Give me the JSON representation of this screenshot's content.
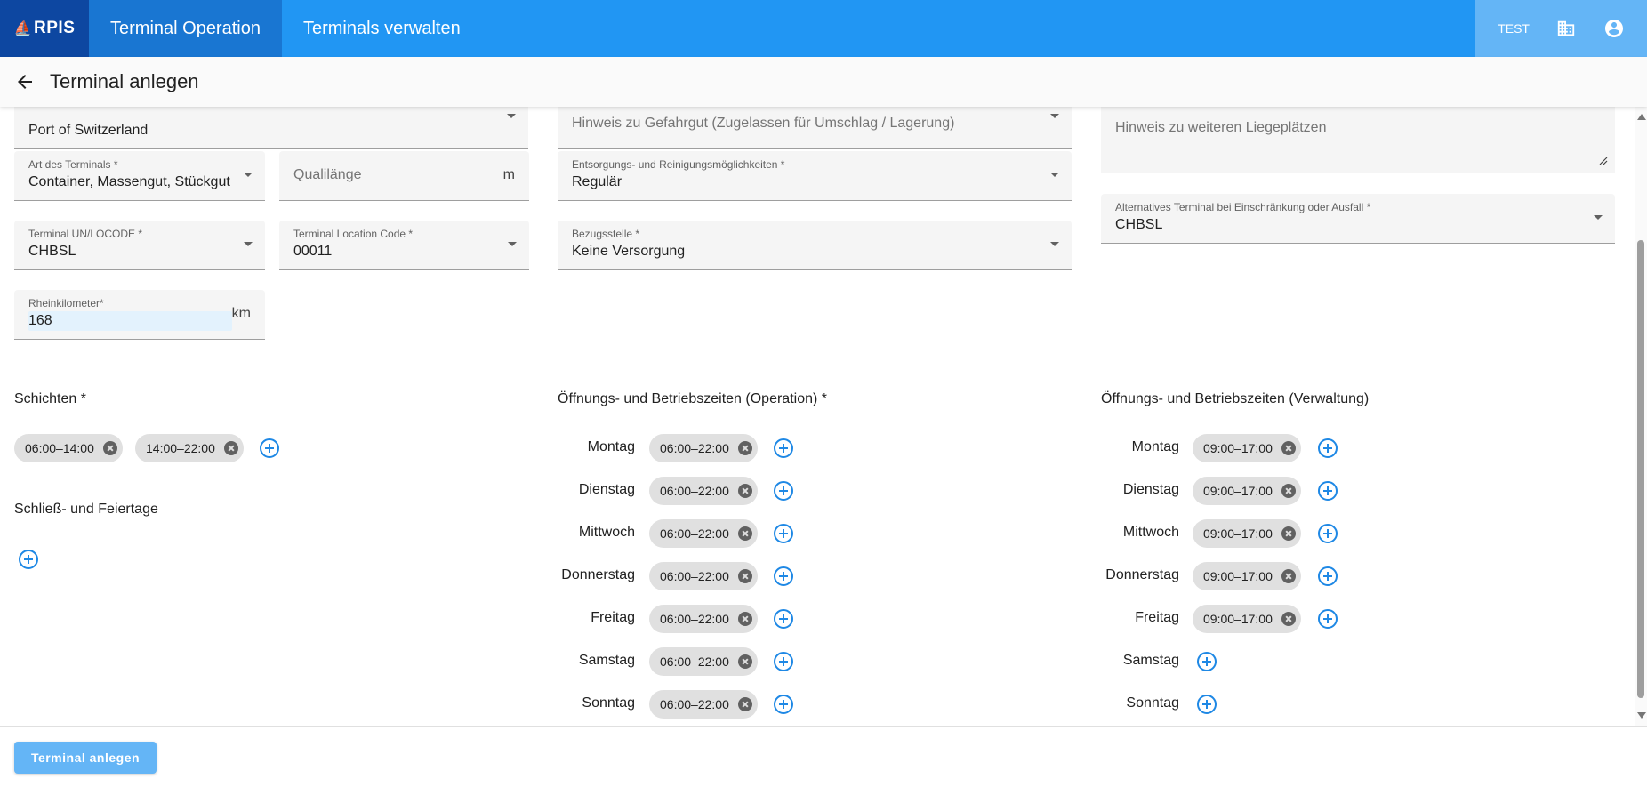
{
  "app": {
    "logo": "RPIS",
    "nav_tabs": [
      {
        "label": "Terminal Operation"
      },
      {
        "label": "Terminals verwalten"
      }
    ],
    "env": "TEST"
  },
  "page": {
    "title": "Terminal anlegen"
  },
  "form": {
    "hafen": {
      "value": "Port of Switzerland"
    },
    "art": {
      "label": "Art des Terminals *",
      "value": "Container, Massengut, Stückgut"
    },
    "quailaenge": {
      "placeholder": "Qualilänge",
      "unit": "m"
    },
    "unlocode": {
      "label": "Terminal UN/LOCODE *",
      "value": "CHBSL"
    },
    "location_code": {
      "label": "Terminal Location Code *",
      "value": "00011"
    },
    "rheinkilometer": {
      "label": "Rheinkilometer*",
      "value": "168",
      "unit": "km"
    },
    "gefahrgut": {
      "placeholder": "Hinweis zu Gefahrgut (Zugelassen für Umschlag / Lagerung)"
    },
    "entsorgung": {
      "label": "Entsorgungs- und Reinigungsmöglichkeiten *",
      "value": "Regulär"
    },
    "bezugsstelle": {
      "label": "Bezugsstelle *",
      "value": "Keine Versorgung"
    },
    "liegeplaetze": {
      "placeholder": "Hinweis zu weiteren Liegeplätzen"
    },
    "alternativ": {
      "label": "Alternatives Terminal bei Einschränkung oder Ausfall *",
      "value": "CHBSL"
    }
  },
  "schichten": {
    "title": "Schichten *",
    "chips": [
      "06:00–14:00",
      "14:00–22:00"
    ]
  },
  "feiertage": {
    "title": "Schließ- und Feiertage"
  },
  "operation": {
    "title": "Öffnungs- und Betriebszeiten (Operation) *",
    "days": [
      {
        "day": "Montag",
        "time": "06:00–22:00"
      },
      {
        "day": "Dienstag",
        "time": "06:00–22:00"
      },
      {
        "day": "Mittwoch",
        "time": "06:00–22:00"
      },
      {
        "day": "Donnerstag",
        "time": "06:00–22:00"
      },
      {
        "day": "Freitag",
        "time": "06:00–22:00"
      },
      {
        "day": "Samstag",
        "time": "06:00–22:00"
      },
      {
        "day": "Sonntag",
        "time": "06:00–22:00"
      }
    ]
  },
  "verwaltung": {
    "title": "Öffnungs- und Betriebszeiten (Verwaltung)",
    "days": [
      {
        "day": "Montag",
        "time": "09:00–17:00"
      },
      {
        "day": "Dienstag",
        "time": "09:00–17:00"
      },
      {
        "day": "Mittwoch",
        "time": "09:00–17:00"
      },
      {
        "day": "Donnerstag",
        "time": "09:00–17:00"
      },
      {
        "day": "Freitag",
        "time": "09:00–17:00"
      },
      {
        "day": "Samstag"
      },
      {
        "day": "Sonntag"
      }
    ]
  },
  "footer": {
    "submit_label": "Terminal anlegen"
  },
  "icons": {
    "logo": "ship-icon",
    "top_right": [
      "business-icon",
      "account-circle-icon"
    ],
    "back": "arrow-back-icon",
    "chip_remove": "cancel-icon",
    "add": "add-circle-outline-icon"
  },
  "colors": {
    "primary": "#2196f3",
    "primary_dark": "#1976d2",
    "logo_bg": "#0d47a1",
    "accent": "#1e88e5",
    "button": "#64b5f6"
  }
}
